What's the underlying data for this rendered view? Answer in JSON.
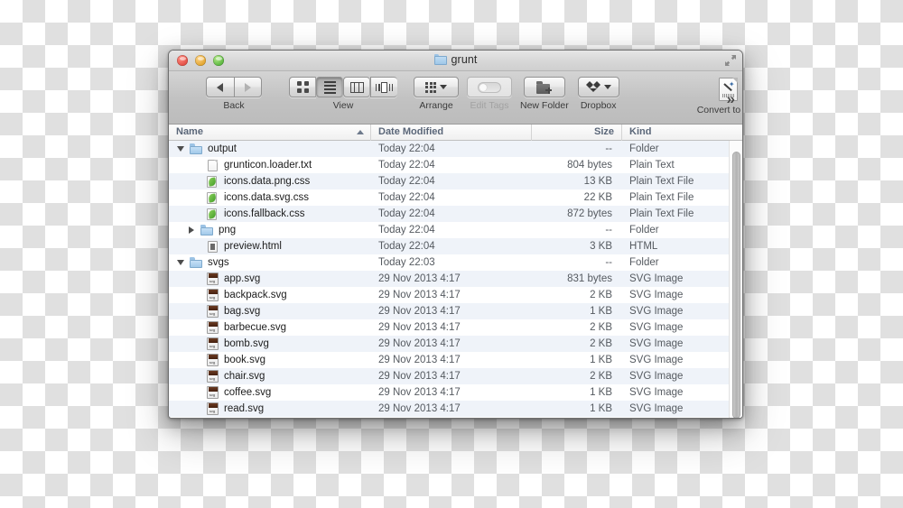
{
  "window": {
    "title": "grunt",
    "title_icon": "folder-icon",
    "traffic_lights": [
      "close-button",
      "minimize-button",
      "maximize-button"
    ],
    "fullscreen_icon": "fullscreen-arrows-icon"
  },
  "toolbar": {
    "back_label": "Back",
    "back_icon": "back-arrow-icon",
    "forward_icon": "forward-arrow-icon",
    "view_label": "View",
    "view_options": [
      "icon-view",
      "list-view",
      "column-view",
      "cover-flow-view"
    ],
    "view_selected": "list-view",
    "arrange_label": "Arrange",
    "arrange_icon": "arrange-grid-icon",
    "edit_tags_label": "Edit Tags",
    "edit_tags_icon": "tag-pill-icon",
    "edit_tags_disabled": true,
    "new_folder_label": "New Folder",
    "new_folder_icon": "new-folder-icon",
    "dropbox_label": "Dropbox",
    "dropbox_icon": "dropbox-icon",
    "convert_label": "Convert to png",
    "convert_icon": "automator-document-icon",
    "overflow_icon": "chevron-double-right-icon",
    "overflow_glyph": "»"
  },
  "columns": [
    {
      "key": "name",
      "label": "Name",
      "sorted": true,
      "sort_direction": "ascending"
    },
    {
      "key": "date",
      "label": "Date Modified",
      "sorted": false
    },
    {
      "key": "size",
      "label": "Size",
      "sorted": false
    },
    {
      "key": "kind",
      "label": "Kind",
      "sorted": false
    }
  ],
  "rows": [
    {
      "name": "output",
      "date": "Today 22:04",
      "size": "--",
      "kind": "Folder",
      "icon": "folder-icon",
      "indent": 0,
      "disclosure": "expanded"
    },
    {
      "name": "grunticon.loader.txt",
      "date": "Today 22:04",
      "size": "804 bytes",
      "kind": "Plain Text",
      "icon": "plain-document-icon",
      "indent": 1,
      "disclosure": "none"
    },
    {
      "name": "icons.data.png.css",
      "date": "Today 22:04",
      "size": "13 KB",
      "kind": "Plain Text File",
      "icon": "css-leaf-document-icon",
      "indent": 1,
      "disclosure": "none"
    },
    {
      "name": "icons.data.svg.css",
      "date": "Today 22:04",
      "size": "22 KB",
      "kind": "Plain Text File",
      "icon": "css-leaf-document-icon",
      "indent": 1,
      "disclosure": "none"
    },
    {
      "name": "icons.fallback.css",
      "date": "Today 22:04",
      "size": "872 bytes",
      "kind": "Plain Text File",
      "icon": "css-leaf-document-icon",
      "indent": 1,
      "disclosure": "none"
    },
    {
      "name": "png",
      "date": "Today 22:04",
      "size": "--",
      "kind": "Folder",
      "icon": "folder-icon",
      "indent": 1,
      "disclosure": "collapsed"
    },
    {
      "name": "preview.html",
      "date": "Today 22:04",
      "size": "3 KB",
      "kind": "HTML",
      "icon": "html-document-icon",
      "indent": 1,
      "disclosure": "none"
    },
    {
      "name": "svgs",
      "date": "Today 22:03",
      "size": "--",
      "kind": "Folder",
      "icon": "folder-icon",
      "indent": 0,
      "disclosure": "expanded"
    },
    {
      "name": "app.svg",
      "date": "29 Nov 2013 4:17",
      "size": "831 bytes",
      "kind": "SVG Image",
      "icon": "svg-document-icon",
      "indent": 1,
      "disclosure": "none"
    },
    {
      "name": "backpack.svg",
      "date": "29 Nov 2013 4:17",
      "size": "2 KB",
      "kind": "SVG Image",
      "icon": "svg-document-icon",
      "indent": 1,
      "disclosure": "none"
    },
    {
      "name": "bag.svg",
      "date": "29 Nov 2013 4:17",
      "size": "1 KB",
      "kind": "SVG Image",
      "icon": "svg-document-icon",
      "indent": 1,
      "disclosure": "none"
    },
    {
      "name": "barbecue.svg",
      "date": "29 Nov 2013 4:17",
      "size": "2 KB",
      "kind": "SVG Image",
      "icon": "svg-document-icon",
      "indent": 1,
      "disclosure": "none"
    },
    {
      "name": "bomb.svg",
      "date": "29 Nov 2013 4:17",
      "size": "2 KB",
      "kind": "SVG Image",
      "icon": "svg-document-icon",
      "indent": 1,
      "disclosure": "none"
    },
    {
      "name": "book.svg",
      "date": "29 Nov 2013 4:17",
      "size": "1 KB",
      "kind": "SVG Image",
      "icon": "svg-document-icon",
      "indent": 1,
      "disclosure": "none"
    },
    {
      "name": "chair.svg",
      "date": "29 Nov 2013 4:17",
      "size": "2 KB",
      "kind": "SVG Image",
      "icon": "svg-document-icon",
      "indent": 1,
      "disclosure": "none"
    },
    {
      "name": "coffee.svg",
      "date": "29 Nov 2013 4:17",
      "size": "1 KB",
      "kind": "SVG Image",
      "icon": "svg-document-icon",
      "indent": 1,
      "disclosure": "none"
    },
    {
      "name": "read.svg",
      "date": "29 Nov 2013 4:17",
      "size": "1 KB",
      "kind": "SVG Image",
      "icon": "svg-document-icon",
      "indent": 1,
      "disclosure": "none"
    }
  ],
  "colors": {
    "row_stripe": "#eff3f9",
    "header_text": "#5a6678",
    "folder_blue": "#a2c9e9",
    "css_leaf_green": "#3f9a26",
    "svg_band": "#45200f"
  }
}
